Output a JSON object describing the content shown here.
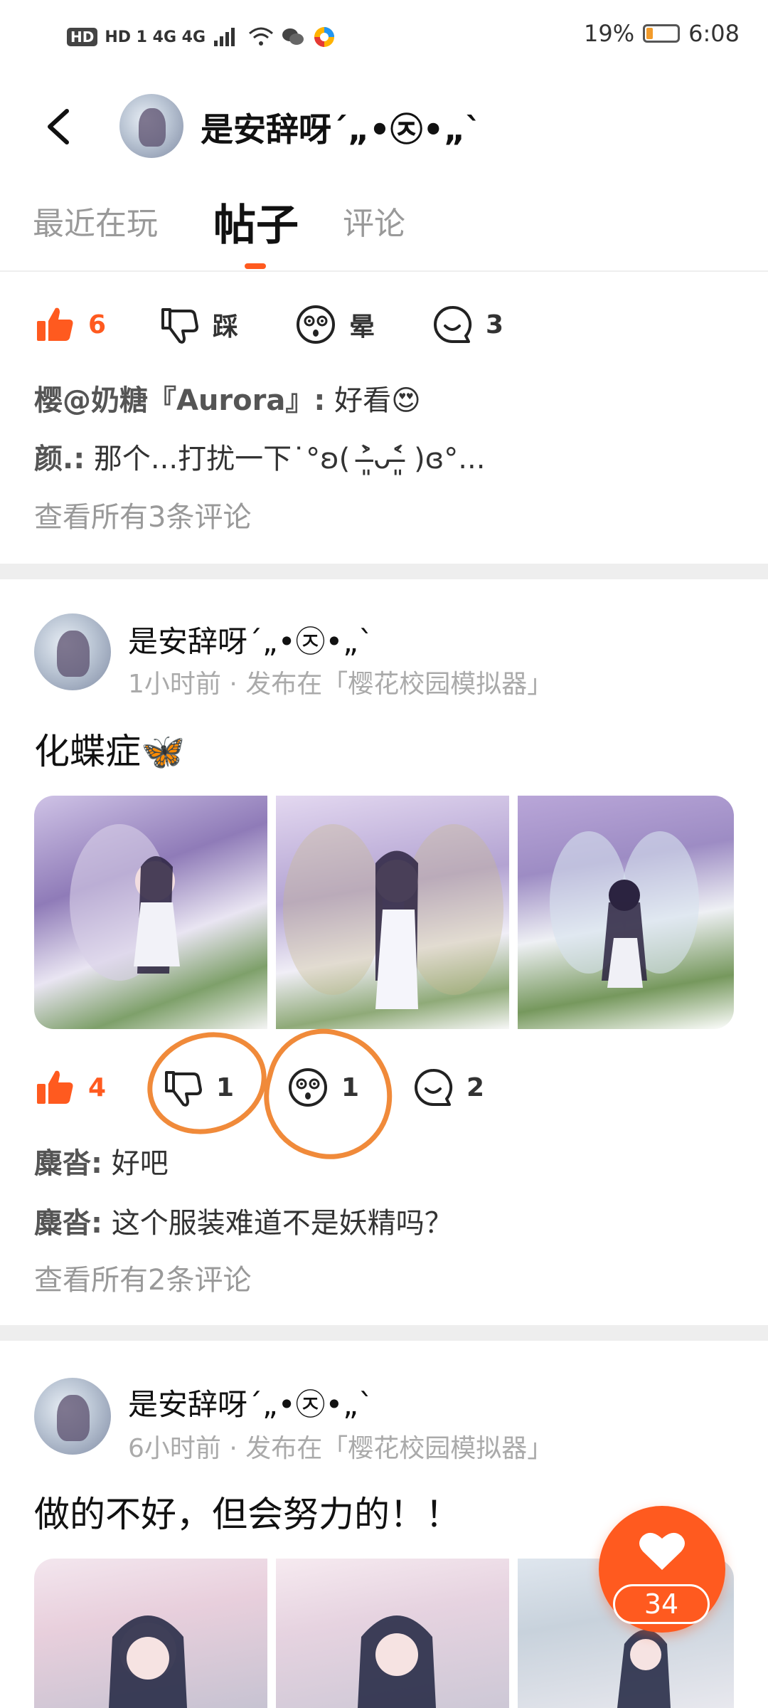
{
  "status_bar": {
    "network": "HD 1  4G  4G",
    "battery": "19%",
    "battery_level": 0.19,
    "time": "6:08"
  },
  "header": {
    "title": "是安辞呀´„•㉨•„`"
  },
  "tabs": [
    {
      "label": "最近在玩",
      "active": false
    },
    {
      "label": "帖子",
      "active": true
    },
    {
      "label": "评论",
      "active": false
    }
  ],
  "post0": {
    "likes": "6",
    "dislike_label": "踩",
    "dizzy_label": "晕",
    "comments": "3",
    "comment_lines": [
      {
        "author": "樱@奶糖『Aurora』:",
        "text": "好看😍"
      },
      {
        "author": "颜.:",
        "text": "那个...打扰一下˙°ʚ( ˃̶͈̀ᴗ˂̶͈́ )ɞ°..."
      }
    ],
    "view_all": "查看所有3条评论"
  },
  "post1": {
    "author": "是安辞呀´„•㉨•„`",
    "meta": "1小时前 · 发布在「樱花校园模拟器」",
    "title": "化蝶症🦋",
    "likes": "4",
    "dislikes": "1",
    "dizzy": "1",
    "comments": "2",
    "comment_lines": [
      {
        "author": "麋沓:",
        "text": "好吧"
      },
      {
        "author": "麋沓:",
        "text": "这个服装难道不是妖精吗？"
      }
    ],
    "view_all": "查看所有2条评论"
  },
  "post2": {
    "author": "是安辞呀´„•㉨•„`",
    "meta": "6小时前 · 发布在「樱花校园模拟器」",
    "title": "做的不好，但会努力的！！"
  },
  "fab": {
    "count": "34"
  },
  "colors": {
    "accent": "#ff5a1f",
    "annotation": "#f08a3a"
  }
}
